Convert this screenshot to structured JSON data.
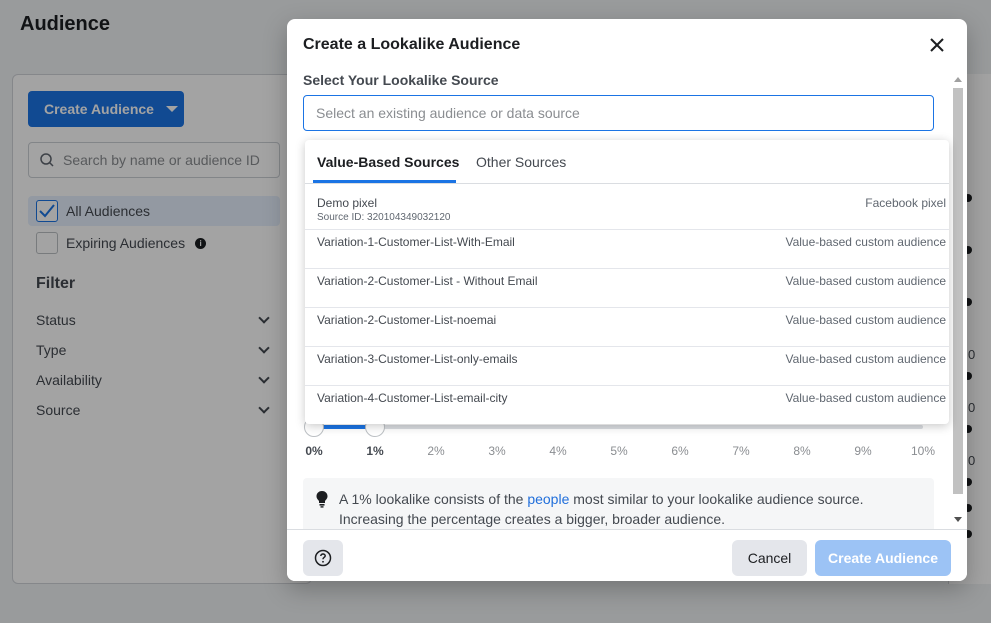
{
  "background": {
    "page_title": "Audience",
    "create_button_label": "Create Audience",
    "search_placeholder": "Search by name or audience ID",
    "quick_filters": [
      {
        "label": "All Audiences",
        "checked": true
      },
      {
        "label": "Expiring Audiences",
        "checked": false
      }
    ],
    "filter_heading": "Filter",
    "filters": [
      "Status",
      "Type",
      "Availability",
      "Source"
    ],
    "edge_values": [
      "0",
      "0",
      "0"
    ]
  },
  "modal": {
    "title": "Create a Lookalike Audience",
    "source_label": "Select Your Lookalike Source",
    "source_placeholder": "Select an existing audience or data source",
    "dropdown": {
      "tabs": [
        {
          "label": "Value-Based Sources",
          "active": true
        },
        {
          "label": "Other Sources",
          "active": false
        }
      ],
      "options": [
        {
          "name": "Demo pixel",
          "sub": "Source ID: 320104349032120",
          "type": "Facebook pixel"
        },
        {
          "name": "Variation-1-Customer-List-With-Email",
          "sub": "",
          "type": "Value-based custom audience"
        },
        {
          "name": "Variation-2-Customer-List - Without Email",
          "sub": "",
          "type": "Value-based custom audience"
        },
        {
          "name": "Variation-2-Customer-List-noemai",
          "sub": "",
          "type": "Value-based custom audience"
        },
        {
          "name": "Variation-3-Customer-List-only-emails",
          "sub": "",
          "type": "Value-based custom audience"
        },
        {
          "name": "Variation-4-Customer-List-email-city",
          "sub": "",
          "type": "Value-based custom audience"
        }
      ]
    },
    "size_slider": {
      "ticks": [
        "0%",
        "1%",
        "2%",
        "3%",
        "4%",
        "5%",
        "6%",
        "7%",
        "8%",
        "9%",
        "10%"
      ],
      "min": 0,
      "max": 10,
      "range_start": 0,
      "range_end": 1
    },
    "info": {
      "text_before": "A 1% lookalike consists of the ",
      "link": "people",
      "text_after": " most similar to your lookalike audience source. Increasing the percentage creates a bigger, broader audience."
    },
    "footer": {
      "cancel_label": "Cancel",
      "create_label": "Create Audience"
    }
  },
  "colors": {
    "accent": "#1b74e4",
    "accent_disabled": "#9cc3f5",
    "link": "#216fdb"
  },
  "icons": [
    "search-icon",
    "check-icon",
    "info-icon",
    "chevron-down-icon",
    "close-icon",
    "lightbulb-icon",
    "help-icon",
    "caret-down-icon"
  ]
}
